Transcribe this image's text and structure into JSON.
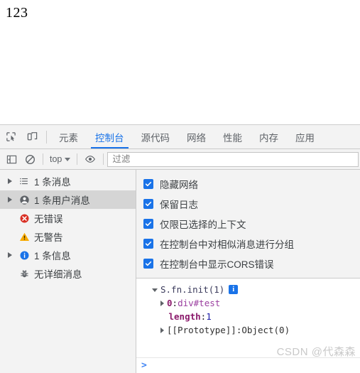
{
  "page": {
    "content_text": "123"
  },
  "devtools": {
    "tabbar": {
      "inspect_icon": "inspect-element-icon",
      "device_icon": "device-toolbar-icon",
      "tabs": [
        {
          "label": "元素",
          "active": false
        },
        {
          "label": "控制台",
          "active": true
        },
        {
          "label": "源代码",
          "active": false
        },
        {
          "label": "网络",
          "active": false
        },
        {
          "label": "性能",
          "active": false
        },
        {
          "label": "内存",
          "active": false
        },
        {
          "label": "应用",
          "active": false
        }
      ]
    },
    "filterbar": {
      "sidebar_toggle_icon": "sidebar-toggle-icon",
      "clear_icon": "clear-console-icon",
      "context_label": "top",
      "eye_icon": "live-expression-eye-icon",
      "filter_placeholder": "过滤",
      "filter_value": ""
    },
    "sidebar": {
      "items": [
        {
          "label": "1 条消息",
          "icon": "list-icon",
          "expandable": true,
          "selected": false
        },
        {
          "label": "1 条用户消息",
          "icon": "user-icon",
          "expandable": true,
          "selected": true
        },
        {
          "label": "无错误",
          "icon": "error-icon",
          "expandable": false,
          "selected": false
        },
        {
          "label": "无警告",
          "icon": "warning-icon",
          "expandable": false,
          "selected": false
        },
        {
          "label": "1 条信息",
          "icon": "info-icon",
          "expandable": true,
          "selected": false
        },
        {
          "label": "无详细消息",
          "icon": "verbose-bug-icon",
          "expandable": false,
          "selected": false
        }
      ]
    },
    "settings": {
      "options": [
        {
          "label": "隐藏网络",
          "checked": true
        },
        {
          "label": "保留日志",
          "checked": true
        },
        {
          "label": "仅限已选择的上下文",
          "checked": true
        },
        {
          "label": "在控制台中对相似消息进行分组",
          "checked": true
        },
        {
          "label": "在控制台中显示CORS错误",
          "checked": true
        }
      ]
    },
    "console_output": {
      "object_header": "S.fn.init(1)",
      "info_badge": "i",
      "rows": [
        {
          "key": "0",
          "sep": ": ",
          "value": "div#test",
          "value_kind": "node",
          "expandable": true
        },
        {
          "key": "length",
          "sep": ": ",
          "value": "1",
          "value_kind": "number",
          "expandable": false
        },
        {
          "key": "[[Prototype]]",
          "sep": ": ",
          "value": "Object(0)",
          "value_kind": "object",
          "expandable": true
        }
      ],
      "prompt_symbol": ">"
    },
    "watermark": "CSDN @代森森"
  },
  "colors": {
    "accent": "#1a73e8",
    "error": "#d93025",
    "warning": "#f9ab00",
    "info": "#1a73e8",
    "panel_bg": "#f3f3f3",
    "selected_row": "#d5d5d5"
  }
}
